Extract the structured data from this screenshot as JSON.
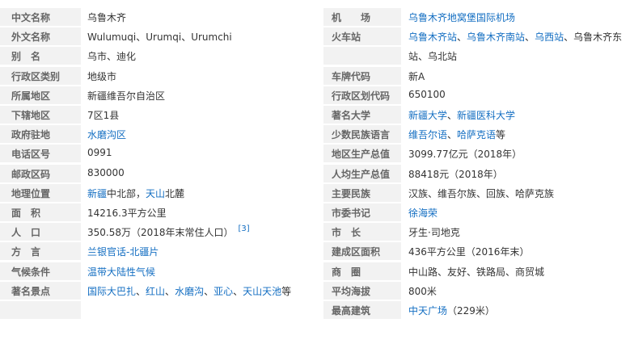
{
  "rows": [
    {
      "left": {
        "label": "中文名称",
        "parts": [
          {
            "t": "乌鲁木齐"
          }
        ]
      },
      "right": {
        "label": "机　　场",
        "parts": [
          {
            "t": "乌鲁木齐地窝堡国际机场",
            "link": true
          }
        ]
      }
    },
    {
      "left": {
        "label": "外文名称",
        "parts": [
          {
            "t": "Wulumuqi、Urumqi、Urumchi"
          }
        ]
      },
      "right": {
        "label": "火车站",
        "parts": [
          {
            "t": "乌鲁木齐站",
            "link": true
          },
          {
            "t": "、"
          },
          {
            "t": "乌鲁木齐南站",
            "link": true
          },
          {
            "t": "、"
          },
          {
            "t": "乌西站",
            "link": true
          },
          {
            "t": "、乌鲁木齐东"
          }
        ]
      }
    },
    {
      "left": {
        "label": "别　名",
        "parts": [
          {
            "t": "乌市、迪化"
          }
        ]
      },
      "right": {
        "label": "",
        "parts": [
          {
            "t": "站、乌北站"
          }
        ]
      }
    },
    {
      "left": {
        "label": "行政区类别",
        "parts": [
          {
            "t": "地级市"
          }
        ]
      },
      "right": {
        "label": "车牌代码",
        "parts": [
          {
            "t": "新A"
          }
        ]
      }
    },
    {
      "left": {
        "label": "所属地区",
        "parts": [
          {
            "t": "新疆维吾尔自治区"
          }
        ]
      },
      "right": {
        "label": "行政区划代码",
        "parts": [
          {
            "t": "650100"
          }
        ]
      }
    },
    {
      "left": {
        "label": "下辖地区",
        "parts": [
          {
            "t": "7区1县"
          }
        ]
      },
      "right": {
        "label": "著名大学",
        "parts": [
          {
            "t": "新疆大学",
            "link": true
          },
          {
            "t": "、"
          },
          {
            "t": "新疆医科大学",
            "link": true
          }
        ]
      }
    },
    {
      "left": {
        "label": "政府驻地",
        "parts": [
          {
            "t": "水磨沟区",
            "link": true
          }
        ]
      },
      "right": {
        "label": "少数民族语言",
        "parts": [
          {
            "t": "维吾尔语",
            "link": true
          },
          {
            "t": "、"
          },
          {
            "t": "哈萨克语",
            "link": true
          },
          {
            "t": "等"
          }
        ]
      }
    },
    {
      "left": {
        "label": "电话区号",
        "parts": [
          {
            "t": "0991"
          }
        ]
      },
      "right": {
        "label": "地区生产总值",
        "parts": [
          {
            "t": "3099.77亿元（2018年）"
          }
        ]
      }
    },
    {
      "left": {
        "label": "邮政区码",
        "parts": [
          {
            "t": "830000"
          }
        ]
      },
      "right": {
        "label": "人均生产总值",
        "parts": [
          {
            "t": "88418元（2018年）"
          }
        ]
      }
    },
    {
      "left": {
        "label": "地理位置",
        "parts": [
          {
            "t": "新疆",
            "link": true
          },
          {
            "t": "中北部，"
          },
          {
            "t": "天山",
            "link": true
          },
          {
            "t": "北麓"
          }
        ]
      },
      "right": {
        "label": "主要民族",
        "parts": [
          {
            "t": "汉族、维吾尔族、回族、哈萨克族"
          }
        ]
      }
    },
    {
      "left": {
        "label": "面　积",
        "parts": [
          {
            "t": "14216.3平方公里"
          }
        ]
      },
      "right": {
        "label": "市委书记",
        "parts": [
          {
            "t": "徐海荣",
            "link": true
          }
        ]
      }
    },
    {
      "left": {
        "label": "人　口",
        "parts": [
          {
            "t": "350.58万（2018年末常住人口）"
          }
        ],
        "sup": "[3]"
      },
      "right": {
        "label": "市　长",
        "parts": [
          {
            "t": "牙生·司地克"
          }
        ]
      }
    },
    {
      "left": {
        "label": "方　言",
        "parts": [
          {
            "t": "兰银官话-北疆片",
            "link": true
          }
        ]
      },
      "right": {
        "label": "建成区面积",
        "parts": [
          {
            "t": "436平方公里（2016年末）"
          }
        ]
      }
    },
    {
      "left": {
        "label": "气候条件",
        "parts": [
          {
            "t": "温带大陆性气候",
            "link": true
          }
        ]
      },
      "right": {
        "label": "商　圈",
        "parts": [
          {
            "t": "中山路、友好、铁路局、商贸城"
          }
        ]
      }
    },
    {
      "left": {
        "label": "著名景点",
        "parts": [
          {
            "t": "国际大巴扎",
            "link": true
          },
          {
            "t": "、"
          },
          {
            "t": "红山",
            "link": true
          },
          {
            "t": "、"
          },
          {
            "t": "水磨沟",
            "link": true
          },
          {
            "t": "、"
          },
          {
            "t": "亚心",
            "link": true
          },
          {
            "t": "、"
          },
          {
            "t": "天山天池",
            "link": true
          },
          {
            "t": "等"
          }
        ]
      },
      "right": {
        "label": "平均海拔",
        "parts": [
          {
            "t": "800米"
          }
        ]
      }
    },
    {
      "left": {
        "label": "",
        "parts": []
      },
      "right": {
        "label": "最高建筑",
        "parts": [
          {
            "t": "中天广场",
            "link": true
          },
          {
            "t": "（229米）"
          }
        ]
      }
    }
  ],
  "colors": {
    "link": "#136ec2",
    "label": "#666666",
    "label_bg": "#f2f2f2",
    "text": "#333333"
  }
}
